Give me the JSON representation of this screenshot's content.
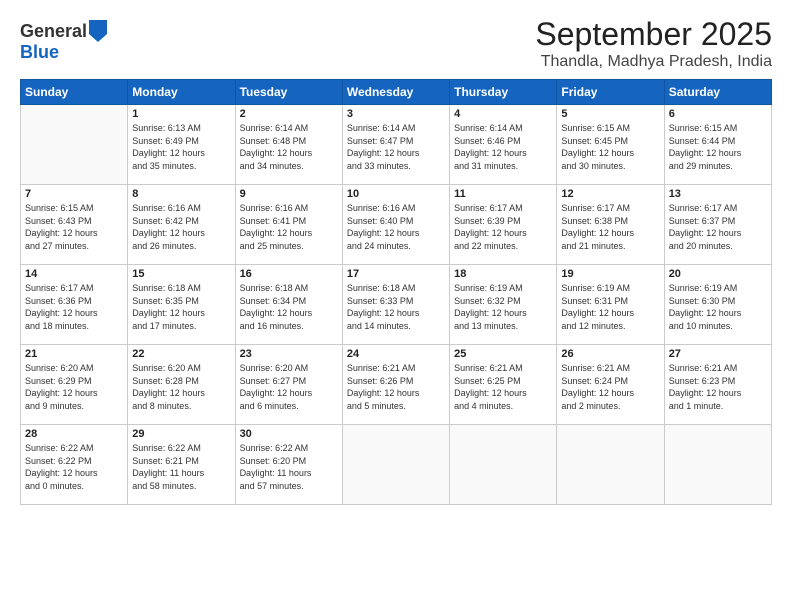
{
  "header": {
    "logo_line1": "General",
    "logo_line2": "Blue",
    "title": "September 2025",
    "subtitle": "Thandla, Madhya Pradesh, India"
  },
  "days_of_week": [
    "Sunday",
    "Monday",
    "Tuesday",
    "Wednesday",
    "Thursday",
    "Friday",
    "Saturday"
  ],
  "weeks": [
    [
      {
        "day": "",
        "info": ""
      },
      {
        "day": "1",
        "info": "Sunrise: 6:13 AM\nSunset: 6:49 PM\nDaylight: 12 hours\nand 35 minutes."
      },
      {
        "day": "2",
        "info": "Sunrise: 6:14 AM\nSunset: 6:48 PM\nDaylight: 12 hours\nand 34 minutes."
      },
      {
        "day": "3",
        "info": "Sunrise: 6:14 AM\nSunset: 6:47 PM\nDaylight: 12 hours\nand 33 minutes."
      },
      {
        "day": "4",
        "info": "Sunrise: 6:14 AM\nSunset: 6:46 PM\nDaylight: 12 hours\nand 31 minutes."
      },
      {
        "day": "5",
        "info": "Sunrise: 6:15 AM\nSunset: 6:45 PM\nDaylight: 12 hours\nand 30 minutes."
      },
      {
        "day": "6",
        "info": "Sunrise: 6:15 AM\nSunset: 6:44 PM\nDaylight: 12 hours\nand 29 minutes."
      }
    ],
    [
      {
        "day": "7",
        "info": "Sunrise: 6:15 AM\nSunset: 6:43 PM\nDaylight: 12 hours\nand 27 minutes."
      },
      {
        "day": "8",
        "info": "Sunrise: 6:16 AM\nSunset: 6:42 PM\nDaylight: 12 hours\nand 26 minutes."
      },
      {
        "day": "9",
        "info": "Sunrise: 6:16 AM\nSunset: 6:41 PM\nDaylight: 12 hours\nand 25 minutes."
      },
      {
        "day": "10",
        "info": "Sunrise: 6:16 AM\nSunset: 6:40 PM\nDaylight: 12 hours\nand 24 minutes."
      },
      {
        "day": "11",
        "info": "Sunrise: 6:17 AM\nSunset: 6:39 PM\nDaylight: 12 hours\nand 22 minutes."
      },
      {
        "day": "12",
        "info": "Sunrise: 6:17 AM\nSunset: 6:38 PM\nDaylight: 12 hours\nand 21 minutes."
      },
      {
        "day": "13",
        "info": "Sunrise: 6:17 AM\nSunset: 6:37 PM\nDaylight: 12 hours\nand 20 minutes."
      }
    ],
    [
      {
        "day": "14",
        "info": "Sunrise: 6:17 AM\nSunset: 6:36 PM\nDaylight: 12 hours\nand 18 minutes."
      },
      {
        "day": "15",
        "info": "Sunrise: 6:18 AM\nSunset: 6:35 PM\nDaylight: 12 hours\nand 17 minutes."
      },
      {
        "day": "16",
        "info": "Sunrise: 6:18 AM\nSunset: 6:34 PM\nDaylight: 12 hours\nand 16 minutes."
      },
      {
        "day": "17",
        "info": "Sunrise: 6:18 AM\nSunset: 6:33 PM\nDaylight: 12 hours\nand 14 minutes."
      },
      {
        "day": "18",
        "info": "Sunrise: 6:19 AM\nSunset: 6:32 PM\nDaylight: 12 hours\nand 13 minutes."
      },
      {
        "day": "19",
        "info": "Sunrise: 6:19 AM\nSunset: 6:31 PM\nDaylight: 12 hours\nand 12 minutes."
      },
      {
        "day": "20",
        "info": "Sunrise: 6:19 AM\nSunset: 6:30 PM\nDaylight: 12 hours\nand 10 minutes."
      }
    ],
    [
      {
        "day": "21",
        "info": "Sunrise: 6:20 AM\nSunset: 6:29 PM\nDaylight: 12 hours\nand 9 minutes."
      },
      {
        "day": "22",
        "info": "Sunrise: 6:20 AM\nSunset: 6:28 PM\nDaylight: 12 hours\nand 8 minutes."
      },
      {
        "day": "23",
        "info": "Sunrise: 6:20 AM\nSunset: 6:27 PM\nDaylight: 12 hours\nand 6 minutes."
      },
      {
        "day": "24",
        "info": "Sunrise: 6:21 AM\nSunset: 6:26 PM\nDaylight: 12 hours\nand 5 minutes."
      },
      {
        "day": "25",
        "info": "Sunrise: 6:21 AM\nSunset: 6:25 PM\nDaylight: 12 hours\nand 4 minutes."
      },
      {
        "day": "26",
        "info": "Sunrise: 6:21 AM\nSunset: 6:24 PM\nDaylight: 12 hours\nand 2 minutes."
      },
      {
        "day": "27",
        "info": "Sunrise: 6:21 AM\nSunset: 6:23 PM\nDaylight: 12 hours\nand 1 minute."
      }
    ],
    [
      {
        "day": "28",
        "info": "Sunrise: 6:22 AM\nSunset: 6:22 PM\nDaylight: 12 hours\nand 0 minutes."
      },
      {
        "day": "29",
        "info": "Sunrise: 6:22 AM\nSunset: 6:21 PM\nDaylight: 11 hours\nand 58 minutes."
      },
      {
        "day": "30",
        "info": "Sunrise: 6:22 AM\nSunset: 6:20 PM\nDaylight: 11 hours\nand 57 minutes."
      },
      {
        "day": "",
        "info": ""
      },
      {
        "day": "",
        "info": ""
      },
      {
        "day": "",
        "info": ""
      },
      {
        "day": "",
        "info": ""
      }
    ]
  ]
}
